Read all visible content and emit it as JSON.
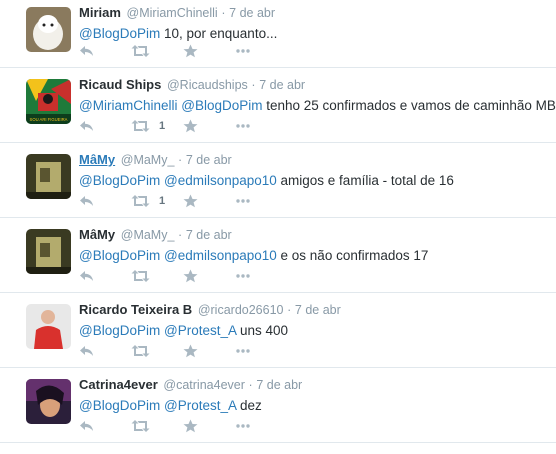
{
  "tweets": [
    {
      "fullname": "Miriam",
      "username": "@MiriamChinelli",
      "time": "7 de abr",
      "text_parts": [
        {
          "type": "mention",
          "text": "@BlogDoPim"
        },
        {
          "type": "text",
          "text": "  10, por enquanto..."
        }
      ],
      "retweet_count": "",
      "avatar_colors": [
        "#8a7a5e",
        "#f2f0ea"
      ]
    },
    {
      "fullname": "Ricaud Ships",
      "username": "@Ricaudships",
      "time": "7 de abr",
      "text_parts": [
        {
          "type": "mention",
          "text": "@MiriamChinelli"
        },
        {
          "type": "text",
          "text": " "
        },
        {
          "type": "mention",
          "text": "@BlogDoPim"
        },
        {
          "type": "text",
          "text": " tenho 25 confirmados e vamos de caminhão MB"
        }
      ],
      "retweet_count": "1",
      "avatar_caption": "SOU ARI FIGUEIRA",
      "avatar_colors": [
        "#1f7a3a",
        "#c8302c",
        "#f3c21b"
      ]
    },
    {
      "fullname": "MâMy",
      "username": "@MaMy_",
      "time": "7 de abr",
      "link_name": true,
      "text_parts": [
        {
          "type": "mention",
          "text": "@BlogDoPim"
        },
        {
          "type": "text",
          "text": " "
        },
        {
          "type": "mention",
          "text": "@edmilsonpapo10"
        },
        {
          "type": "text",
          "text": " amigos e família - total de 16"
        }
      ],
      "retweet_count": "1",
      "avatar_colors": [
        "#3a3a22",
        "#c9c07a"
      ]
    },
    {
      "fullname": "MâMy",
      "username": "@MaMy_",
      "time": "7 de abr",
      "text_parts": [
        {
          "type": "mention",
          "text": "@BlogDoPim"
        },
        {
          "type": "text",
          "text": " "
        },
        {
          "type": "mention",
          "text": "@edmilsonpapo10"
        },
        {
          "type": "text",
          "text": " e os não confirmados 17"
        }
      ],
      "retweet_count": "",
      "avatar_colors": [
        "#3a3a22",
        "#c9c07a"
      ]
    },
    {
      "fullname": "Ricardo Teixeira B",
      "username": "@ricardo26610",
      "time": "7 de abr",
      "text_parts": [
        {
          "type": "mention",
          "text": "@BlogDoPim"
        },
        {
          "type": "text",
          "text": " "
        },
        {
          "type": "mention",
          "text": "@Protest_A"
        },
        {
          "type": "text",
          "text": " uns 400"
        }
      ],
      "retweet_count": "",
      "avatar_colors": [
        "#e8e8e8",
        "#d9312d",
        "#e2b59a"
      ]
    },
    {
      "fullname": "Catrina4ever",
      "username": "@catrina4ever",
      "time": "7 de abr",
      "text_parts": [
        {
          "type": "mention",
          "text": "@BlogDoPim"
        },
        {
          "type": "text",
          "text": " "
        },
        {
          "type": "mention",
          "text": "@Protest_A"
        },
        {
          "type": "text",
          "text": " dez"
        }
      ],
      "retweet_count": "",
      "avatar_colors": [
        "#2b1f3a",
        "#8a3d8f",
        "#d8a07a"
      ]
    }
  ],
  "separator": "·",
  "icons": {
    "reply": "reply-icon",
    "retweet": "retweet-icon",
    "favorite": "star-icon",
    "more": "more-icon"
  },
  "colors": {
    "mention": "#2b7bb9",
    "meta": "#8899a6",
    "action": "#aab8c2",
    "divider": "#e1e8ed"
  }
}
